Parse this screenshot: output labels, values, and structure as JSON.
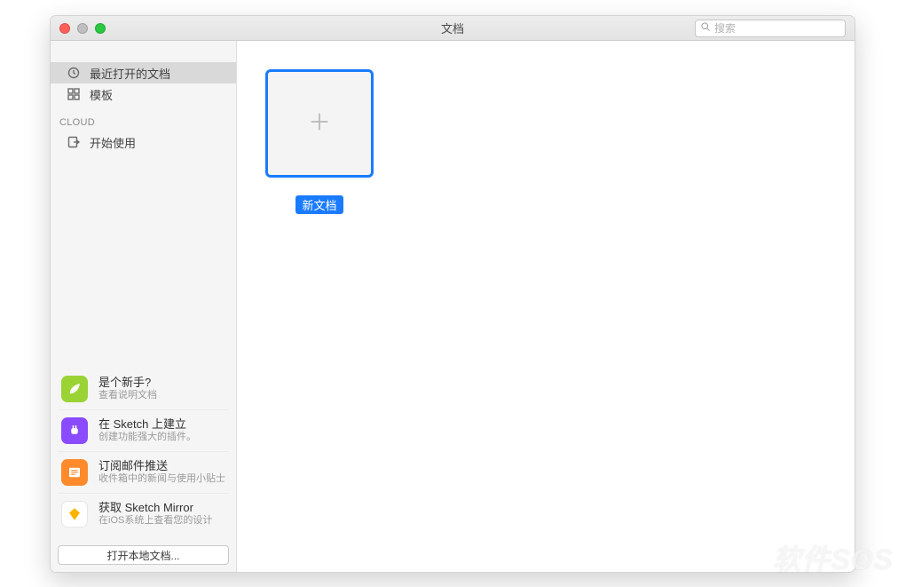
{
  "window": {
    "title": "文档"
  },
  "search": {
    "placeholder": "搜索"
  },
  "sidebar": {
    "items": [
      {
        "label": "最近打开的文档"
      },
      {
        "label": "模板"
      }
    ],
    "cloud_header": "CLOUD",
    "cloud_items": [
      {
        "label": "开始使用"
      }
    ]
  },
  "promos": [
    {
      "title": "是个新手?",
      "subtitle": "查看说明文档",
      "badge_color": "#9bd335"
    },
    {
      "title": "在 Sketch 上建立",
      "subtitle": "创建功能强大的插件。",
      "badge_color": "#8a4bff"
    },
    {
      "title": "订阅邮件推送",
      "subtitle": "收件箱中的新闻与使用小贴士",
      "badge_color": "#ff8a2b"
    },
    {
      "title": "获取 Sketch Mirror",
      "subtitle": "在iOS系统上查看您的设计",
      "badge_color": "#ffffff"
    }
  ],
  "open_local_button": "打开本地文档...",
  "main": {
    "new_document_label": "新文档"
  },
  "watermark": "软件SOS"
}
